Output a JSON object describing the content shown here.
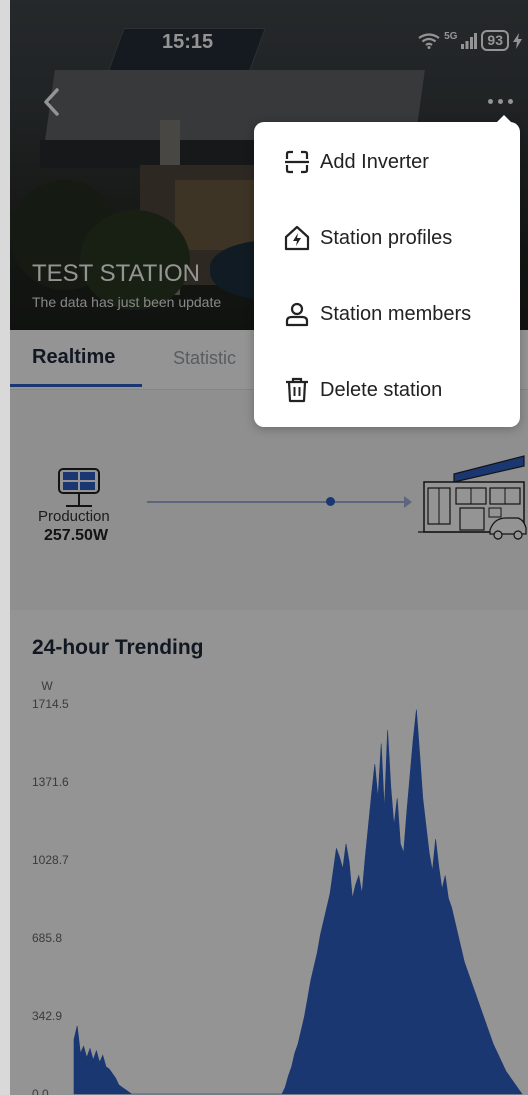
{
  "status_bar": {
    "time": "15:15",
    "network": "5G",
    "battery": "93"
  },
  "station": {
    "name": "TEST STATION",
    "subtitle": "The data has just been update"
  },
  "tabs": [
    {
      "label": "Realtime"
    },
    {
      "label": "Statistic"
    }
  ],
  "flow": {
    "production_label": "Production",
    "production_value": "257.50W"
  },
  "menu": {
    "items": [
      {
        "label": "Add Inverter",
        "icon": "scan-icon"
      },
      {
        "label": "Station profiles",
        "icon": "home-power-icon"
      },
      {
        "label": "Station members",
        "icon": "user-icon"
      },
      {
        "label": "Delete station",
        "icon": "trash-icon"
      }
    ]
  },
  "chart_data": {
    "type": "area",
    "title": "24-hour Trending",
    "ylabel": "W",
    "yticks": [
      "1714.5",
      "1371.6",
      "1028.7",
      "685.8",
      "342.9",
      "0.0"
    ],
    "ylim": [
      0,
      1714.5
    ],
    "color": "#2e5fc4",
    "series": [
      {
        "values": [
          240,
          300,
          180,
          210,
          160,
          200,
          150,
          190,
          140,
          170,
          120,
          110,
          90,
          70,
          40,
          30,
          20,
          10,
          0,
          0,
          0,
          0,
          0,
          0,
          0,
          0,
          0,
          0,
          0,
          0,
          0,
          0,
          0,
          0,
          0,
          0,
          0,
          0,
          0,
          0,
          0,
          0,
          0,
          0,
          0,
          0,
          0,
          0,
          0,
          0,
          0,
          0,
          0,
          0,
          0,
          0,
          0,
          0,
          0,
          0,
          0,
          0,
          0,
          0,
          0,
          0,
          30,
          80,
          120,
          180,
          220,
          280,
          340,
          420,
          500,
          560,
          620,
          700,
          760,
          820,
          880,
          980,
          1080,
          1040,
          990,
          1100,
          1020,
          860,
          920,
          960,
          880,
          1040,
          1180,
          1320,
          1450,
          1300,
          1540,
          1250,
          1600,
          1350,
          1180,
          1300,
          1100,
          1060,
          1240,
          1400,
          1560,
          1690,
          1500,
          1300,
          1180,
          1060,
          980,
          1120,
          1000,
          900,
          960,
          860,
          820,
          760,
          700,
          640,
          580,
          540,
          500,
          460,
          420,
          380,
          340,
          300,
          260,
          220,
          190,
          160,
          130,
          100,
          80,
          60,
          40,
          20,
          0
        ]
      }
    ]
  }
}
